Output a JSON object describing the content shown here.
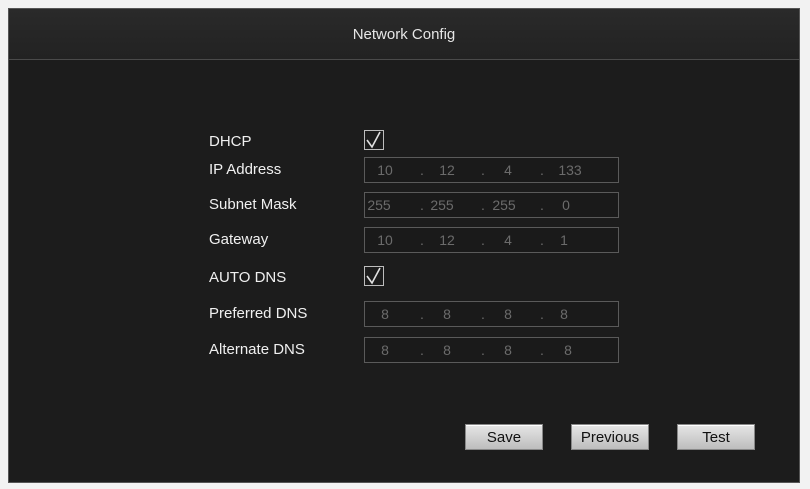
{
  "window": {
    "title": "Network Config"
  },
  "fields": {
    "dhcp": {
      "label": "DHCP",
      "checked": true
    },
    "ip_address": {
      "label": "IP Address",
      "octets": [
        "10",
        "12",
        "4",
        "133"
      ]
    },
    "subnet_mask": {
      "label": "Subnet Mask",
      "octets": [
        "255",
        "255",
        "255",
        "0"
      ]
    },
    "gateway": {
      "label": "Gateway",
      "octets": [
        "10",
        "12",
        "4",
        "1"
      ]
    },
    "auto_dns": {
      "label": "AUTO DNS",
      "checked": true
    },
    "preferred_dns": {
      "label": "Preferred DNS",
      "octets": [
        "8",
        "8",
        "8",
        "8"
      ]
    },
    "alternate_dns": {
      "label": "Alternate DNS",
      "octets": [
        "8",
        "8",
        "8",
        "8"
      ]
    }
  },
  "buttons": {
    "save": "Save",
    "previous": "Previous",
    "test": "Test"
  },
  "icons": {
    "checkmark": "checkmark-icon"
  }
}
